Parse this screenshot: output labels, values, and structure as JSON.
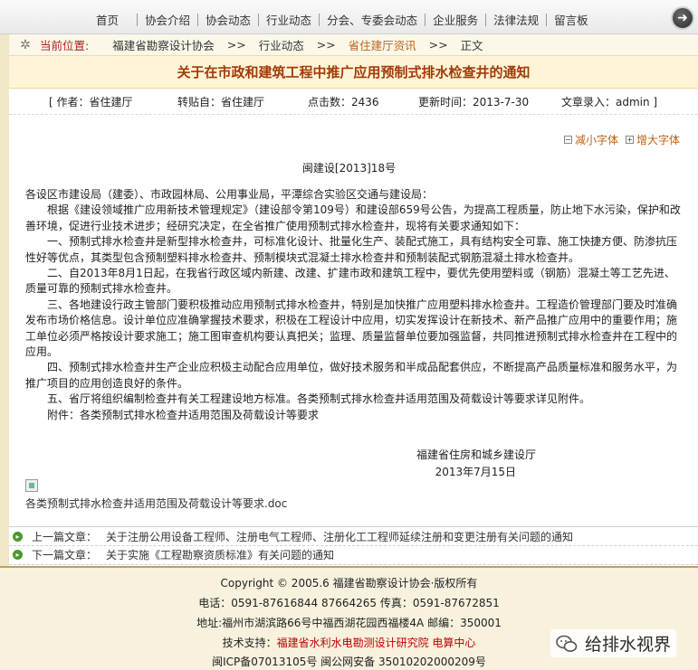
{
  "nav": {
    "items": [
      "首页",
      "协会介绍",
      "协会动态",
      "行业动态",
      "分会、专委会动态",
      "企业服务",
      "法律法规",
      "留言板"
    ]
  },
  "breadcrumb": {
    "label": "当前位置:",
    "items": [
      "福建省勘察设计协会",
      "行业动态",
      "省住建厅资讯",
      "正文"
    ],
    "sep": ">>"
  },
  "article": {
    "title": "关于在市政和建筑工程中推广应用预制式排水检查井的通知",
    "meta": {
      "author": "[ 作者：省住建厅",
      "source": "转贴自：省住建厅",
      "hits": "点击数：2436",
      "updated": "更新时间：2013-7-30",
      "editor": "文章录入：admin ]"
    },
    "font_small": "减小字体",
    "font_large": "增大字体",
    "doc_no": "闽建设[2013]18号",
    "paragraphs": [
      "各设区市建设局（建委）、市政园林局、公用事业局，平潭综合实验区交通与建设局：",
      "根据《建设领域推广应用新技术管理规定》（建设部令第109号）和建设部659号公告，为提高工程质量，防止地下水污染，保护和改善环境，促进行业技术进步；经研究决定，在全省推广使用预制式排水检查井，现将有关要求通知如下：",
      "一、预制式排水检查井是新型排水检查井，可标准化设计、批量化生产、装配式施工，具有结构安全可靠、施工快捷方便、防渗抗压性好等优点，其类型包含预制塑料排水检查井、预制模块式混凝土排水检查井和预制装配式钢筋混凝土排水检查井。",
      "二、自2013年8月1日起，在我省行政区域内新建、改建、扩建市政和建筑工程中，要优先使用塑料或（钢筋）混凝土等工艺先进、质量可靠的预制式排水检查井。",
      "三、各地建设行政主管部门要积极推动应用预制式排水检查井，特别是加快推广应用塑料排水检查井。工程造价管理部门要及时准确发布市场价格信息。设计单位应准确掌握技术要求，积极在工程设计中应用，切实发挥设计在新技术、新产品推广应用中的重要作用；施工单位必须严格按设计要求施工；施工图审查机构要认真把关；监理、质量监督单位要加强监督，共同推进预制式排水检查井在工程中的应用。",
      "四、预制式排水检查井生产企业应积极主动配合应用单位，做好技术服务和半成品配套供应，不断提高产品质量标准和服务水平，为推广项目的应用创造良好的条件。",
      "五、省厅将组织编制检查井有关工程建设地方标准。各类预制式排水检查井适用范围及荷载设计等要求详见附件。",
      "附件：各类预制式排水检查井适用范围及荷载设计等要求"
    ],
    "signer": "福建省住房和城乡建设厅",
    "sign_date": "2013年7月15日",
    "attachment": "各类预制式排水检查井适用范围及荷载设计等要求.doc"
  },
  "prev": {
    "label": "上一篇文章：",
    "title": "关于注册公用设备工程师、注册电气工程师、注册化工工程师延续注册和变更注册有关问题的通知"
  },
  "next": {
    "label": "下一篇文章：",
    "title": "关于实施《工程勘察资质标准》有关问题的通知"
  },
  "footer": {
    "copyright": "Copyright © 2005.6   福建省勘察设计协会·版权所有",
    "phone": "电话：0591-87616844 87664265   传真：0591-87672851",
    "address": "地址:福州市湖滨路66号中福西湖花园西福楼4A 邮编：350001",
    "support_label": "技术支持：",
    "support": "福建省水利水电勘测设计研究院 电算中心",
    "icp": "闽ICP备07013105号 闽公网安备 35010202000209号"
  },
  "watermark": "给排水视界",
  "colors": {
    "title": "#a33a0a",
    "accent": "#c06010",
    "footer_bg": "#f7f1de"
  }
}
